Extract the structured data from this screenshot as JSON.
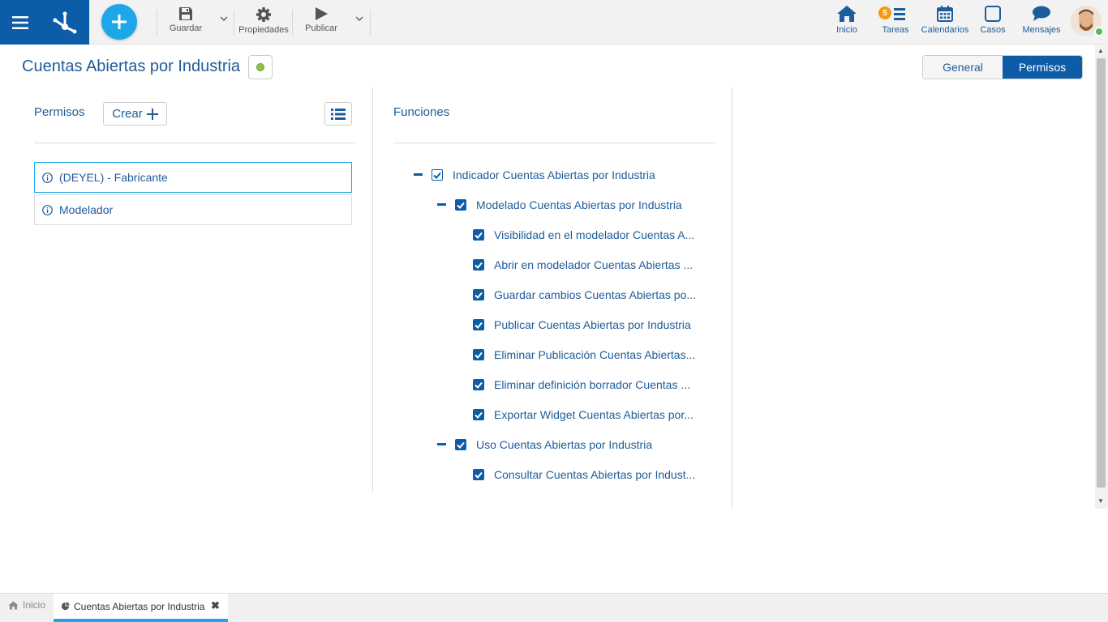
{
  "toolbar": {
    "save_label": "Guardar",
    "properties_label": "Propiedades",
    "publish_label": "Publicar"
  },
  "nav": {
    "home_label": "Inicio",
    "tasks_label": "Tareas",
    "tasks_badge": "5",
    "calendars_label": "Calendarios",
    "cases_label": "Casos",
    "messages_label": "Mensajes"
  },
  "page": {
    "title": "Cuentas Abiertas por Industria",
    "status_color": "#8bc34a"
  },
  "view_tabs": {
    "general": "General",
    "permissions": "Permisos",
    "active": "Permisos"
  },
  "permissions": {
    "label": "Permisos",
    "create_label": "Crear",
    "items": [
      {
        "label": "(DEYEL) - Fabricante",
        "selected": true
      },
      {
        "label": "Modelador",
        "selected": false
      }
    ]
  },
  "functions": {
    "label": "Funciones",
    "tree": [
      {
        "level": 0,
        "expanded": true,
        "checked": true,
        "label": "Indicador Cuentas Abiertas por Industria"
      },
      {
        "level": 1,
        "expanded": true,
        "checked": true,
        "label": "Modelado Cuentas Abiertas por Industria"
      },
      {
        "level": 2,
        "checked": true,
        "label": "Visibilidad en el modelador Cuentas A..."
      },
      {
        "level": 2,
        "checked": true,
        "label": "Abrir en modelador Cuentas Abiertas ..."
      },
      {
        "level": 2,
        "checked": true,
        "label": "Guardar cambios Cuentas Abiertas po..."
      },
      {
        "level": 2,
        "checked": true,
        "label": "Publicar Cuentas Abiertas por Industria"
      },
      {
        "level": 2,
        "checked": true,
        "label": "Eliminar Publicación Cuentas Abiertas..."
      },
      {
        "level": 2,
        "checked": true,
        "label": "Eliminar definición borrador Cuentas ..."
      },
      {
        "level": 2,
        "checked": true,
        "label": "Exportar Widget Cuentas Abiertas por..."
      },
      {
        "level": 1,
        "expanded": true,
        "checked": true,
        "label": "Uso Cuentas Abiertas por Industria"
      },
      {
        "level": 2,
        "checked": true,
        "label": "Consultar Cuentas Abiertas por Indust..."
      }
    ]
  },
  "bottom_tabs": {
    "home_label": "Inicio",
    "active_label": "Cuentas Abiertas por Industria"
  },
  "colors": {
    "brand": "#0d5ca8",
    "accent": "#1ea7e8",
    "badge": "#f39c12"
  }
}
